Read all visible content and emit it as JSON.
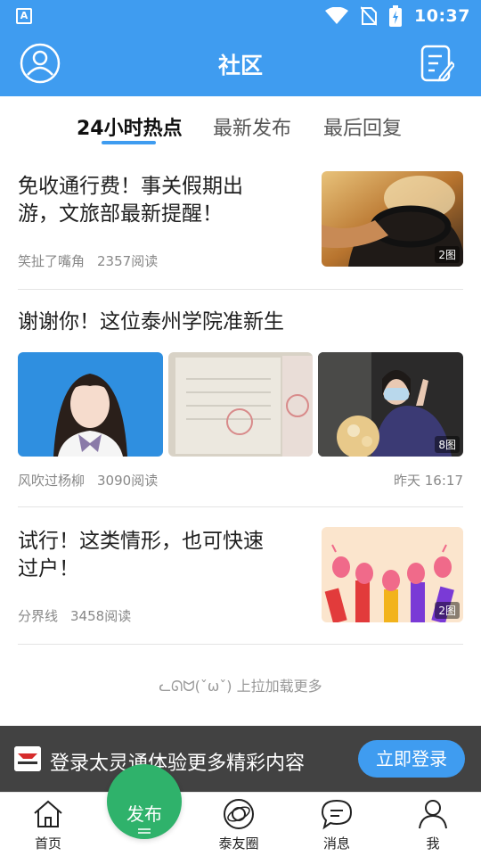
{
  "status_bar": {
    "time": "10:37",
    "app_icon_letter": "A"
  },
  "header": {
    "title": "社区"
  },
  "tabs": [
    {
      "label": "24小时热点",
      "active": true
    },
    {
      "label": "最新发布",
      "active": false
    },
    {
      "label": "最后回复",
      "active": false
    }
  ],
  "posts": [
    {
      "title_line1": "免收通行费！事关假期出",
      "title_line2": "游，文旅部最新提醒！",
      "author": "笑扯了嘴角",
      "reads": "2357阅读",
      "image_badge": "2图"
    },
    {
      "title": "谢谢你！这位泰州学院准新生",
      "author": "风吹过杨柳",
      "reads": "3090阅读",
      "time": "昨天 16:17",
      "image_badge": "8图"
    },
    {
      "title_line1": "试行！这类情形，也可快速",
      "title_line2": "过户！",
      "author": "分界线",
      "reads": "3458阅读",
      "image_badge": "2图"
    }
  ],
  "load_more": "ᓚᘏᗢ(ˇωˇ) 上拉加载更多",
  "login_banner": {
    "text": "登录太灵通体验更多精彩内容",
    "button": "立即登录"
  },
  "bottom_nav": {
    "home": "首页",
    "publish": "发布",
    "circle": "泰友圈",
    "messages": "消息",
    "me": "我"
  },
  "colors": {
    "brand_blue": "#3f9cf0",
    "publish_green": "#2fb26b"
  }
}
